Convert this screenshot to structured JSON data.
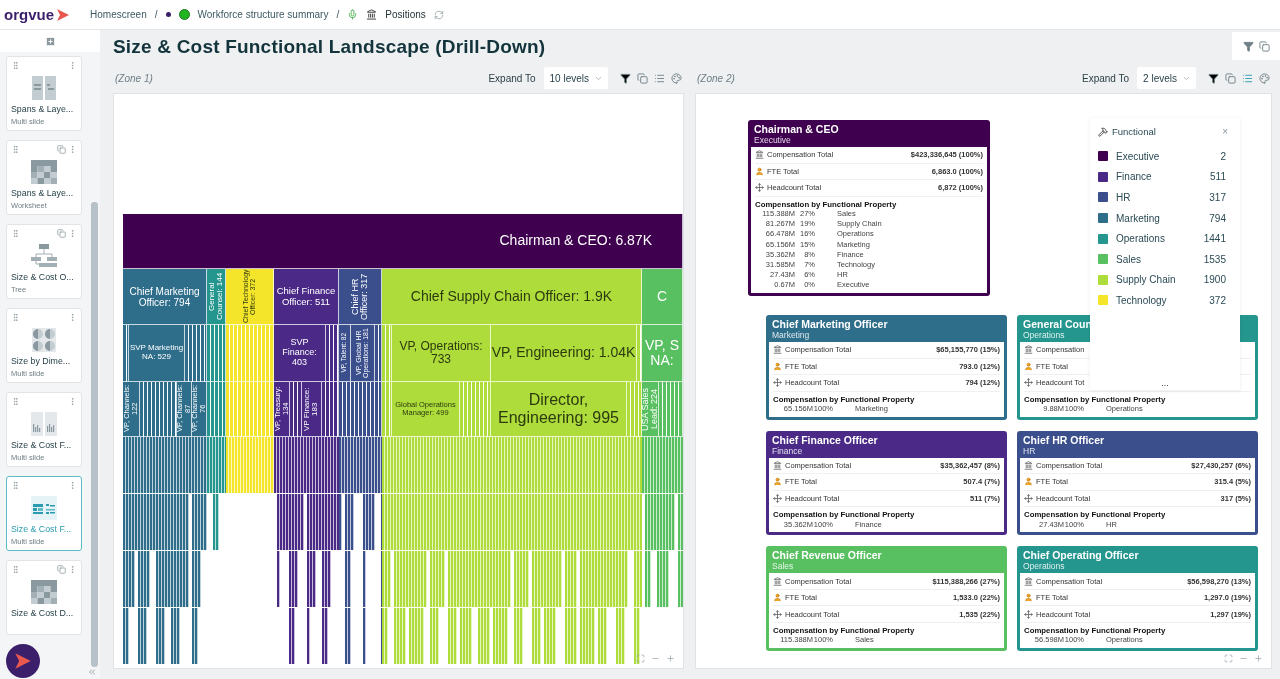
{
  "header": {
    "logo": "orgvue",
    "breadcrumbs": [
      {
        "label": "Homescreen",
        "kind": "text"
      },
      {
        "label": "Workforce structure summary",
        "kind": "status",
        "separator": "/"
      },
      {
        "label": "Positions",
        "kind": "dataset",
        "separator": "/"
      }
    ]
  },
  "sidebar": {
    "slides": [
      {
        "title": "Spans & Laye...",
        "type": "Multi slide",
        "kind": "grid",
        "shared": false,
        "selected": false
      },
      {
        "title": "Spans & Laye...",
        "type": "Worksheet",
        "kind": "sheet",
        "shared": true,
        "selected": false
      },
      {
        "title": "Size & Cost O...",
        "type": "Tree",
        "kind": "tree",
        "shared": true,
        "selected": false
      },
      {
        "title": "Size by Dime...",
        "type": "Multi slide",
        "kind": "pies",
        "shared": false,
        "selected": false
      },
      {
        "title": "Size & Cost F...",
        "type": "Multi slide",
        "kind": "bars",
        "shared": false,
        "selected": false
      },
      {
        "title": "Size & Cost F...",
        "type": "Multi slide",
        "kind": "treemap",
        "shared": false,
        "selected": true
      },
      {
        "title": "Size & Cost D...",
        "kind": "sheet",
        "shared": true,
        "selected": false
      }
    ]
  },
  "page": {
    "title": "Size & Cost Functional Landscape (Drill-Down)"
  },
  "zones": [
    {
      "name": "(Zone 1)",
      "expand_label": "Expand To",
      "expand_value": "10 levels",
      "tools": [
        {
          "kind": "filter",
          "selected": false
        },
        {
          "kind": "copy",
          "selected": false
        },
        {
          "kind": "list",
          "selected": false
        },
        {
          "kind": "palette",
          "selected": false
        }
      ]
    },
    {
      "name": "(Zone 2)",
      "expand_label": "Expand To",
      "expand_value": "2 levels",
      "tools": [
        {
          "kind": "filter",
          "selected": false
        },
        {
          "kind": "copy",
          "selected": false
        },
        {
          "kind": "list",
          "selected": true
        },
        {
          "kind": "palette",
          "selected": false
        }
      ]
    }
  ],
  "treemap": {
    "levels": [
      {
        "tiles": [
          {
            "label": "Chairman & CEO: 6.87K",
            "color": "#3f0050",
            "kind": "horizontal"
          }
        ]
      },
      {
        "tiles": [
          {
            "label": "Chief Marketing Officer: 794",
            "color": "#2e6e8a",
            "kind": "horizontal"
          },
          {
            "label": "General Counsel: 144",
            "color": "#25968e",
            "kind": "vertical"
          },
          {
            "label": "Chief Technology Officer: 372",
            "color": "#f5e52a",
            "kind": "vertical"
          },
          {
            "label": "Chief Finance Officer: 511",
            "color": "#4a2a86",
            "kind": "horizontal"
          },
          {
            "label": "Chief HR Officer: 317",
            "color": "#3b4f8c",
            "kind": "vertical"
          },
          {
            "label": "Chief Supply Chain Officer: 1.9K",
            "color": "#aedc3a",
            "kind": "horizontal"
          },
          {
            "label": "C",
            "color": "#58c060",
            "kind": "horizontal"
          }
        ]
      },
      {
        "tiles": [
          {
            "color": "#2e6e8a",
            "kind": "blank"
          },
          {
            "label": "SVP Marketing NA: 529",
            "color": "#2e6e8a",
            "kind": "horizontal"
          },
          {
            "color": "#2e6e8a",
            "kind": "blank"
          },
          {
            "color": "#25968e",
            "kind": "blank"
          },
          {
            "color": "#f5e52a",
            "kind": "blank"
          },
          {
            "label": "SVP Finance: 403",
            "color": "#4a2a86",
            "kind": "horizontal"
          },
          {
            "color": "#4a2a86",
            "kind": "blank"
          },
          {
            "label": "VP, Talent: 82",
            "color": "#3b4f8c",
            "kind": "vertical"
          },
          {
            "label": "VP, Global HR Operations: 181",
            "color": "#3b4f8c",
            "kind": "vertical"
          },
          {
            "color": "#3b4f8c",
            "kind": "blank"
          },
          {
            "color": "#aedc3a",
            "kind": "blank"
          },
          {
            "label": "VP, Operations: 733",
            "color": "#aedc3a",
            "kind": "horizontal"
          },
          {
            "label": "VP, Engineering: 1.04K",
            "color": "#aedc3a",
            "kind": "horizontal"
          },
          {
            "color": "#aedc3a",
            "kind": "blank"
          },
          {
            "label": "VP, S NA:",
            "color": "#58c060",
            "kind": "horizontal"
          }
        ]
      },
      {
        "tiles": [
          {
            "label": "VP, Channels: 122",
            "color": "#2e6e8a",
            "kind": "vertical"
          },
          {
            "color": "#2e6e8a",
            "kind": "blank"
          },
          {
            "label": "VP, Channels: 87",
            "color": "#2e6e8a",
            "kind": "vertical"
          },
          {
            "label": "VP, Channels: 76",
            "color": "#2e6e8a",
            "kind": "vertical"
          },
          {
            "color": "#25968e",
            "kind": "blank"
          },
          {
            "color": "#f5e52a",
            "kind": "blank"
          },
          {
            "label": "VP, Treasury: 134",
            "color": "#4a2a86",
            "kind": "vertical"
          },
          {
            "color": "#4a2a86",
            "kind": "blank"
          },
          {
            "label": "VP Finance: 183",
            "color": "#4a2a86",
            "kind": "vertical"
          },
          {
            "color": "#4a2a86",
            "kind": "blank"
          },
          {
            "color": "#3b4f8c",
            "kind": "blank"
          },
          {
            "color": "#aedc3a",
            "kind": "blank"
          },
          {
            "label": "Global Operations Manager: 499",
            "color": "#aedc3a",
            "kind": "horizontal"
          },
          {
            "color": "#aedc3a",
            "kind": "blank"
          },
          {
            "label": "Director, Engineering: 995",
            "color": "#aedc3a",
            "kind": "horizontal"
          },
          {
            "color": "#aedc3a",
            "kind": "blank"
          },
          {
            "label": "USA Sales Lead: 224",
            "color": "#58c060",
            "kind": "vertical"
          },
          {
            "color": "#58c060",
            "kind": "blank"
          }
        ]
      }
    ]
  },
  "org": {
    "root": {
      "title": "Chairman & CEO",
      "function": "Executive",
      "color": "#3f0050",
      "metrics": [
        {
          "kind": "compensation",
          "label": "Compensation Total",
          "value": "$423,336,645 (100%)"
        },
        {
          "kind": "fte",
          "label": "FTE Total",
          "value": "6,863.0 (100%)"
        },
        {
          "kind": "headcount",
          "label": "Headcount Total",
          "value": "6,872 (100%)"
        }
      ],
      "breakdown_title": "Compensation by Functional Property",
      "breakdown": [
        {
          "amount": "115.388M",
          "share": "27%",
          "name": "Sales"
        },
        {
          "amount": "81.267M",
          "share": "19%",
          "name": "Supply Chain"
        },
        {
          "amount": "66.478M",
          "share": "16%",
          "name": "Operations"
        },
        {
          "amount": "65.156M",
          "share": "15%",
          "name": "Marketing"
        },
        {
          "amount": "35.362M",
          "share": "8%",
          "name": "Finance"
        },
        {
          "amount": "31.585M",
          "share": "7%",
          "name": "Technology"
        },
        {
          "amount": "27.43M",
          "share": "6%",
          "name": "HR"
        },
        {
          "amount": "0.67M",
          "share": "0%",
          "name": "Executive"
        }
      ]
    },
    "children": [
      {
        "title": "Chief Marketing Officer",
        "function": "Marketing",
        "color": "#2e6e8a",
        "metrics": [
          {
            "kind": "compensation",
            "label": "Compensation Total",
            "value": "$65,155,770 (15%)"
          },
          {
            "kind": "fte",
            "label": "FTE Total",
            "value": "793.0 (12%)"
          },
          {
            "kind": "headcount",
            "label": "Headcount Total",
            "value": "794 (12%)"
          }
        ],
        "breakdown_title": "Compensation by Functional Property",
        "breakdown": [
          {
            "amount": "65.156M",
            "share": "100%",
            "name": "Marketing"
          }
        ]
      },
      {
        "title": "General Coun",
        "function": "Operations",
        "color": "#25968e",
        "metrics": [
          {
            "kind": "compensation",
            "label": "Compensation"
          },
          {
            "kind": "fte",
            "label": "FTE Total"
          },
          {
            "kind": "headcount",
            "label": "Headcount Tot"
          }
        ],
        "breakdown_title": "Compensation by Functional Property",
        "breakdown": [
          {
            "amount": "9.88M",
            "share": "100%",
            "name": "Operations"
          }
        ]
      },
      {
        "title": "Chief Finance Officer",
        "function": "Finance",
        "color": "#4a2a86",
        "metrics": [
          {
            "kind": "compensation",
            "label": "Compensation Total",
            "value": "$35,362,457 (8%)"
          },
          {
            "kind": "fte",
            "label": "FTE Total",
            "value": "507.4 (7%)"
          },
          {
            "kind": "headcount",
            "label": "Headcount Total",
            "value": "511 (7%)"
          }
        ],
        "breakdown_title": "Compensation by Functional Property",
        "breakdown": [
          {
            "amount": "35.362M",
            "share": "100%",
            "name": "Finance"
          }
        ]
      },
      {
        "title": "Chief HR Officer",
        "function": "HR",
        "color": "#3b4f8c",
        "metrics": [
          {
            "kind": "compensation",
            "label": "Compensation Total",
            "value": "$27,430,257 (6%)"
          },
          {
            "kind": "fte",
            "label": "FTE Total",
            "value": "315.4 (5%)"
          },
          {
            "kind": "headcount",
            "label": "Headcount Total",
            "value": "317 (5%)"
          }
        ],
        "breakdown_title": "Compensation by Functional Property",
        "breakdown": [
          {
            "amount": "27.43M",
            "share": "100%",
            "name": "HR"
          }
        ]
      },
      {
        "title": "Chief Revenue Officer",
        "function": "Sales",
        "color": "#58c060",
        "metrics": [
          {
            "kind": "compensation",
            "label": "Compensation Total",
            "value": "$115,388,266 (27%)"
          },
          {
            "kind": "fte",
            "label": "FTE Total",
            "value": "1,533.0 (22%)"
          },
          {
            "kind": "headcount",
            "label": "Headcount Total",
            "value": "1,535 (22%)"
          }
        ],
        "breakdown_title": "Compensation by Functional Property",
        "breakdown": [
          {
            "amount": "115.388M",
            "share": "100%",
            "name": "Sales"
          }
        ]
      },
      {
        "title": "Chief Operating Officer",
        "function": "Operations",
        "color": "#25968e",
        "metrics": [
          {
            "kind": "compensation",
            "label": "Compensation Total",
            "value": "$56,598,270 (13%)"
          },
          {
            "kind": "fte",
            "label": "FTE Total",
            "value": "1,297.0 (19%)"
          },
          {
            "kind": "headcount",
            "label": "Headcount Total",
            "value": "1,297 (19%)"
          }
        ],
        "breakdown_title": "Compensation by Functional Property",
        "breakdown": [
          {
            "amount": "56.598M",
            "share": "100%",
            "name": "Operations"
          }
        ]
      }
    ]
  },
  "legend": {
    "title": "Functional",
    "close": "×",
    "more": "...",
    "items": [
      {
        "name": "Executive",
        "count": "2",
        "color": "#3f0050"
      },
      {
        "name": "Finance",
        "count": "511",
        "color": "#4a2a86"
      },
      {
        "name": "HR",
        "count": "317",
        "color": "#3b4f8c"
      },
      {
        "name": "Marketing",
        "count": "794",
        "color": "#2e6e8a"
      },
      {
        "name": "Operations",
        "count": "1441",
        "color": "#25968e"
      },
      {
        "name": "Sales",
        "count": "1535",
        "color": "#58c060"
      },
      {
        "name": "Supply Chain",
        "count": "1900",
        "color": "#aedc3a"
      },
      {
        "name": "Technology",
        "count": "372",
        "color": "#f5e52a"
      }
    ]
  }
}
